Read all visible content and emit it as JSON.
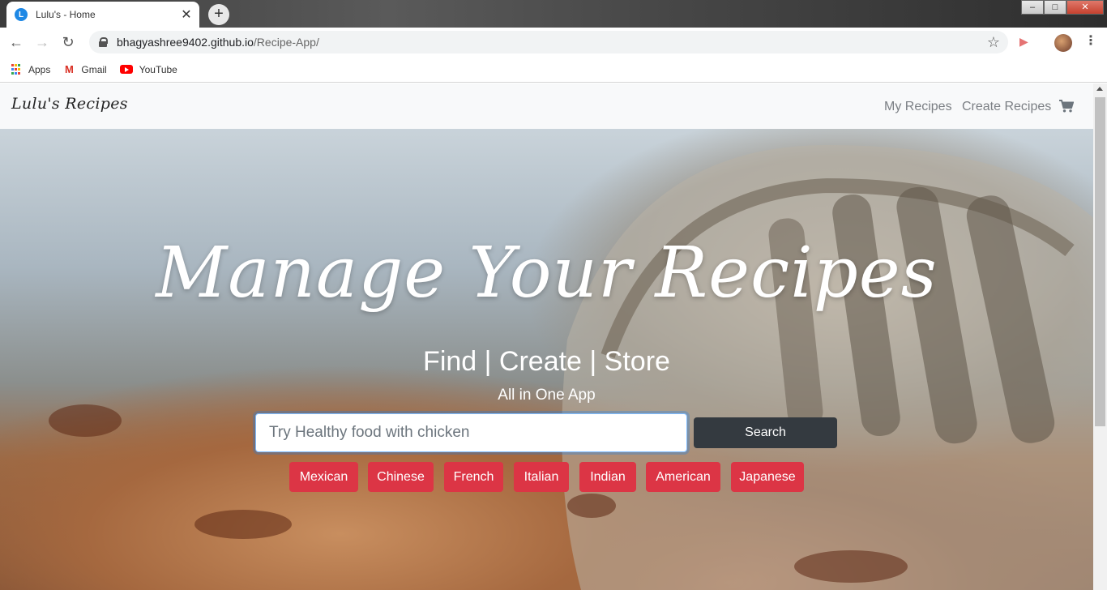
{
  "browser": {
    "tab_title": "Lulu's - Home",
    "tab_favicon_letter": "L",
    "close_glyph": "✕",
    "new_tab_glyph": "+",
    "url_host": "bhagyashree9402.github.io",
    "url_path": "/Recipe-App/",
    "bookmarks": [
      {
        "label": "Apps",
        "icon": "apps-grid-icon"
      },
      {
        "label": "Gmail",
        "icon": "gmail-icon"
      },
      {
        "label": "YouTube",
        "icon": "youtube-icon"
      }
    ]
  },
  "navbar": {
    "brand": "Lulu's Recipes",
    "links": [
      "My Recipes",
      "Create Recipes"
    ],
    "cart_icon": "shopping-cart-icon"
  },
  "hero": {
    "title": "Manage Your Recipes",
    "subtitle": "Find | Create | Store",
    "tagline": "All in One App",
    "search_placeholder": "Try Healthy food with chicken",
    "search_button": "Search",
    "cuisines": [
      "Mexican",
      "Chinese",
      "French",
      "Italian",
      "Indian",
      "American",
      "Japanese"
    ]
  },
  "colors": {
    "accent_red": "#dc3545",
    "dark_button": "#343a40",
    "navbar_bg": "#f8f9fa",
    "focus_border": "#80bdff"
  }
}
